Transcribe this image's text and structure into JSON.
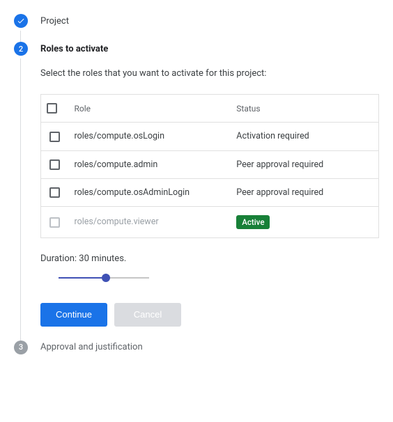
{
  "steps": {
    "project": {
      "label": "Project"
    },
    "roles": {
      "number": "2",
      "label": "Roles to activate",
      "instruction": "Select the roles that you want to activate for this project:",
      "table": {
        "headers": {
          "role": "Role",
          "status": "Status"
        },
        "rows": [
          {
            "role": "roles/compute.osLogin",
            "status": "Activation required",
            "active": false,
            "disabled": false
          },
          {
            "role": "roles/compute.admin",
            "status": "Peer approval required",
            "active": false,
            "disabled": false
          },
          {
            "role": "roles/compute.osAdminLogin",
            "status": "Peer approval required",
            "active": false,
            "disabled": false
          },
          {
            "role": "roles/compute.viewer",
            "status": "Active",
            "active": true,
            "disabled": true
          }
        ]
      },
      "duration_label": "Duration: 30 minutes.",
      "buttons": {
        "continue": "Continue",
        "cancel": "Cancel"
      }
    },
    "approval": {
      "number": "3",
      "label": "Approval and justification"
    }
  }
}
